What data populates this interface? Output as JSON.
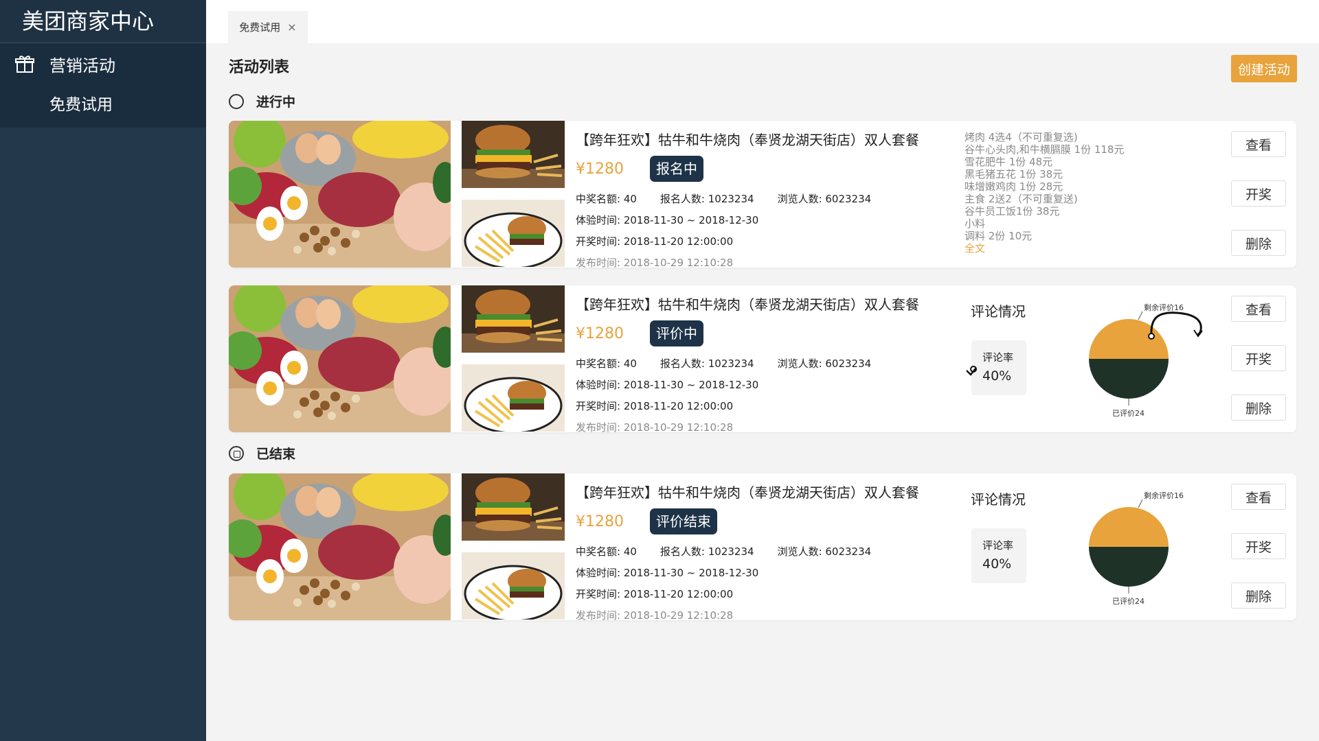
{
  "app": {
    "brand": "美团商家中心"
  },
  "sidebar": {
    "marketing_label": "营销活动",
    "marketing_icon": "gift-icon",
    "sub_item": "免费试用"
  },
  "tabbar": {
    "tab_label": "免费试用",
    "close_glyph": "×"
  },
  "page": {
    "title": "活动列表",
    "create_button": "创建活动"
  },
  "sections": {
    "ongoing": "进行中",
    "ended": "已结束"
  },
  "colors": {
    "accent": "#e8a33c",
    "dark": "#1e3347",
    "sidebar": "#23384b",
    "pie_top": "#e8a33c",
    "pie_bottom": "#1f3228"
  },
  "cards": [
    {
      "title": "【跨年狂欢】牯牛和牛烧肉（奉贤龙湖天街店）双人套餐",
      "price": "¥1280",
      "status": "报名中",
      "stats": [
        "中奖名额: 40",
        "报名人数: 1023234",
        "浏览人数: 6023234"
      ],
      "exp_time": "体验时间: 2018-11-30 ~ 2018-12-30",
      "draw_time": "开奖时间: 2018-11-20 12:00:00",
      "pub_time": "发布时间: 2018-10-29 12:10:28",
      "menu": [
        "烤肉 4选4（不可重复选)",
        "谷牛心头肉,和牛横膈膜 1份 118元",
        "雪花肥牛 1份 48元",
        "黑毛猪五花 1份 38元",
        "味增嫩鸡肉 1份 28元",
        "主食 2送2（不可重复送)",
        "谷牛员工饭1份 38元",
        "小料",
        "调料 2份 10元"
      ],
      "menu_more": "全文",
      "actions": [
        "查看",
        "开奖",
        "删除"
      ]
    },
    {
      "title": "【跨年狂欢】牯牛和牛烧肉（奉贤龙湖天街店）双人套餐",
      "price": "¥1280",
      "status": "评价中",
      "stats": [
        "中奖名额: 40",
        "报名人数: 1023234",
        "浏览人数: 6023234"
      ],
      "exp_time": "体验时间: 2018-11-30 ~ 2018-12-30",
      "draw_time": "开奖时间: 2018-11-20 12:00:00",
      "pub_time": "发布时间: 2018-10-29 12:10:28",
      "eval_title": "评论情况",
      "rate_label": "评论率",
      "rate_value": "40%",
      "pie_top_label": "剩余评价16",
      "pie_bottom_label": "已评价24",
      "pie_remaining": 16,
      "pie_done": 24,
      "actions": [
        "查看",
        "开奖",
        "删除"
      ]
    },
    {
      "title": "【跨年狂欢】牯牛和牛烧肉（奉贤龙湖天街店）双人套餐",
      "price": "¥1280",
      "status": "评价结束",
      "stats": [
        "中奖名额: 40",
        "报名人数: 1023234",
        "浏览人数: 6023234"
      ],
      "exp_time": "体验时间: 2018-11-30 ~ 2018-12-30",
      "draw_time": "开奖时间: 2018-11-20 12:00:00",
      "pub_time": "发布时间: 2018-10-29 12:10:28",
      "eval_title": "评论情况",
      "rate_label": "评论率",
      "rate_value": "40%",
      "pie_top_label": "剩余评价16",
      "pie_bottom_label": "已评价24",
      "pie_remaining": 16,
      "pie_done": 24,
      "actions": [
        "查看",
        "开奖",
        "删除"
      ]
    }
  ]
}
